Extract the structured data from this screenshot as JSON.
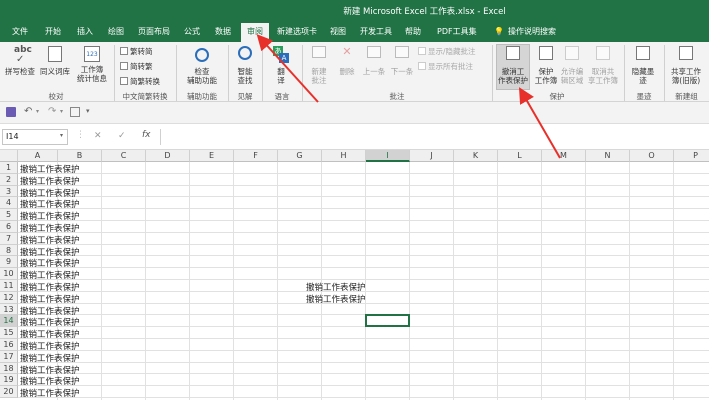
{
  "window": {
    "title": "新建 Microsoft Excel 工作表.xlsx - Excel"
  },
  "tabs": [
    {
      "label": "文件"
    },
    {
      "label": "开始"
    },
    {
      "label": "插入"
    },
    {
      "label": "绘图"
    },
    {
      "label": "页面布局"
    },
    {
      "label": "公式"
    },
    {
      "label": "数据"
    },
    {
      "label": "审阅"
    },
    {
      "label": "新建选项卡"
    },
    {
      "label": "视图"
    },
    {
      "label": "开发工具"
    },
    {
      "label": "帮助"
    },
    {
      "label": "PDF工具集"
    },
    {
      "label": "操作说明搜索"
    }
  ],
  "ribbon": {
    "proofing": {
      "spell_check": "拼写检查",
      "thesaurus": "同义词库",
      "workbook_stats_line1": "工作簿",
      "workbook_stats_line2": "统计信息",
      "group_label": "校对"
    },
    "chinese": {
      "trad_to_simp": "繁转简",
      "simp_to_trad": "简转繁",
      "convert": "简繁转换",
      "group_label": "中文简繁转换"
    },
    "accessibility": {
      "check_line1": "检查",
      "check_line2": "辅助功能",
      "group_label": "辅助功能"
    },
    "insights": {
      "smart_lookup_line1": "智能",
      "smart_lookup_line2": "查找",
      "group_label": "见解"
    },
    "language": {
      "translate_line1": "翻",
      "translate_line2": "译",
      "group_label": "语言"
    },
    "comments": {
      "new_line1": "新建",
      "new_line2": "批注",
      "delete": "删除",
      "previous": "上一条",
      "next": "下一条",
      "show_hide": "显示/隐藏批注",
      "show_all": "显示所有批注",
      "group_label": "批注"
    },
    "protect": {
      "unprotect_line1": "撤消工",
      "unprotect_line2": "作表保护",
      "protect_wb_line1": "保护",
      "protect_wb_line2": "工作簿",
      "allow_edit_line1": "允许编",
      "allow_edit_line2": "辑区域",
      "unshare_line1": "取消共",
      "unshare_line2": "享工作簿",
      "group_label": "保护"
    },
    "ink": {
      "hide_line1": "隐藏墨",
      "hide_line2": "迹",
      "group_label": "墨迹"
    },
    "share": {
      "share_line1": "共享工作",
      "share_line2": "簿(旧版)",
      "group_label": "新建组"
    }
  },
  "formula_bar": {
    "name_box": "I14",
    "cancel": "✕",
    "enter": "✓",
    "fx": "fx",
    "value": ""
  },
  "sheet": {
    "columns": [
      "A",
      "B",
      "C",
      "D",
      "E",
      "F",
      "G",
      "H",
      "I",
      "J",
      "K",
      "L",
      "M",
      "N",
      "O",
      "P"
    ],
    "selected_column": "I",
    "rows": [
      "1",
      "2",
      "3",
      "4",
      "5",
      "6",
      "7",
      "8",
      "9",
      "10",
      "11",
      "12",
      "13",
      "14",
      "15",
      "16",
      "17",
      "18",
      "19",
      "20"
    ],
    "selected_row": "14",
    "col_a_text": "撤销工作表保护",
    "h_cells": [
      {
        "row": 11,
        "text": "撤销工作表保护"
      },
      {
        "row": 12,
        "text": "撤销工作表保护"
      }
    ]
  }
}
